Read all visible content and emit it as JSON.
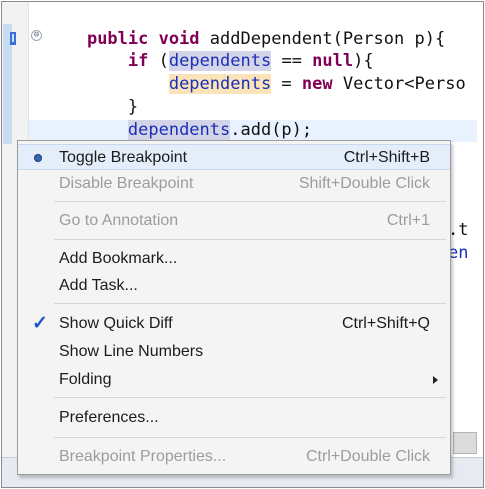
{
  "editor": {
    "code_lines": [
      {
        "indent": "    ",
        "parts": [
          [
            "kw",
            "public void "
          ],
          [
            "plain",
            "addDependent(Person p){"
          ]
        ]
      },
      {
        "indent": "        ",
        "parts": [
          [
            "kw",
            "if "
          ],
          [
            "plain",
            "("
          ],
          [
            "fldocc",
            "dependents"
          ],
          [
            "plain",
            " == "
          ],
          [
            "kw",
            "null"
          ],
          [
            "plain",
            "){"
          ]
        ]
      },
      {
        "indent": "            ",
        "parts": [
          [
            "fldocc2",
            "dependents"
          ],
          [
            "plain",
            " = "
          ],
          [
            "kw",
            "new "
          ],
          [
            "plain",
            "Vector<Perso"
          ]
        ]
      },
      {
        "indent": "        ",
        "parts": [
          [
            "plain",
            "}"
          ]
        ]
      },
      {
        "indent": "        ",
        "parts": [
          [
            "fldocc",
            "dependents"
          ],
          [
            "plain",
            ".add(p);"
          ]
        ]
      }
    ],
    "partial_right_text_1": ".t",
    "partial_right_text_2": "en",
    "fold_symbol": "⊖"
  },
  "context_menu": {
    "items": [
      {
        "label": "Toggle Breakpoint",
        "shortcut": "Ctrl+Shift+B",
        "enabled": true,
        "selected": true,
        "icon": "breakpoint-dot-icon"
      },
      {
        "label": "Disable Breakpoint",
        "shortcut": "Shift+Double Click",
        "enabled": false
      },
      {
        "label": "Go to Annotation",
        "shortcut": "Ctrl+1",
        "enabled": false
      },
      {
        "label": "Add Bookmark...",
        "shortcut": "",
        "enabled": true
      },
      {
        "label": "Add Task...",
        "shortcut": "",
        "enabled": true
      },
      {
        "label": "Show Quick Diff",
        "shortcut": "Ctrl+Shift+Q",
        "enabled": true,
        "checked": true,
        "icon": "checkmark-icon"
      },
      {
        "label": "Show Line Numbers",
        "shortcut": "",
        "enabled": true
      },
      {
        "label": "Folding",
        "shortcut": "",
        "enabled": true,
        "submenu": true
      },
      {
        "label": "Preferences...",
        "shortcut": "",
        "enabled": true
      },
      {
        "label": "Breakpoint Properties...",
        "shortcut": "Ctrl+Double Click",
        "enabled": false
      }
    ],
    "check_glyph": "✓"
  },
  "colors": {
    "keyword": "#7f0055",
    "field": "#1a2fb8",
    "menu_bg": "#f4f4f4",
    "selected_bg": "#e4eefa"
  }
}
